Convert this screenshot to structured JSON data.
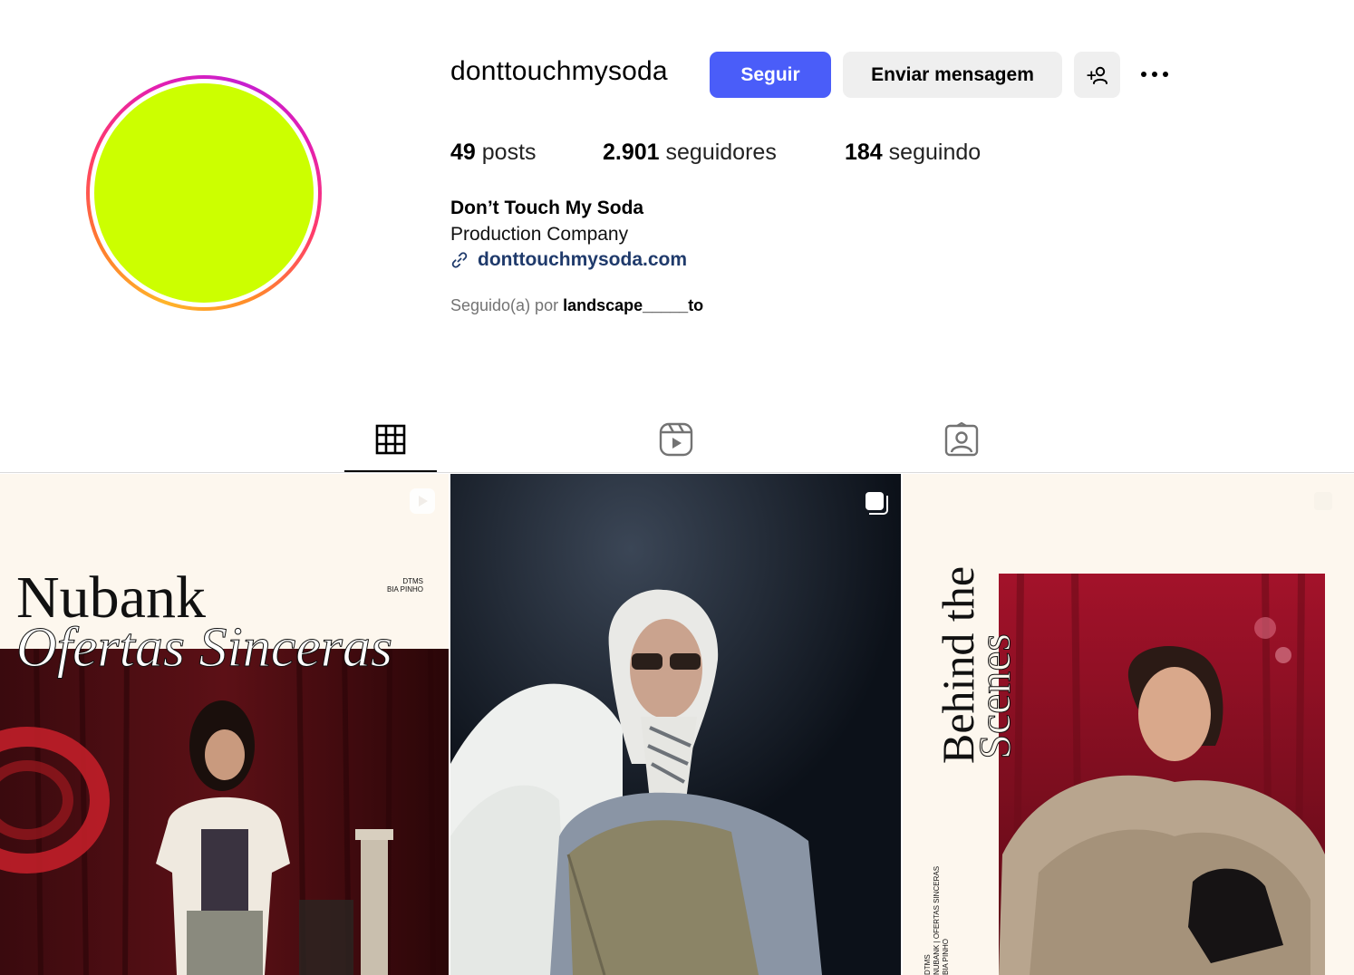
{
  "profile": {
    "username": "donttouchmysoda",
    "avatar_color": "#ccff00",
    "has_story_ring": true
  },
  "actions": {
    "follow_label": "Seguir",
    "message_label": "Enviar mensagem",
    "add_user_icon": "add-person-icon",
    "more_icon": "more-options-icon",
    "follow_color": "#4a5df9"
  },
  "stats": {
    "posts_count": "49",
    "posts_label": "posts",
    "followers_count": "2.901",
    "followers_label": "seguidores",
    "following_count": "184",
    "following_label": "seguindo"
  },
  "bio": {
    "name": "Don’t Touch My Soda",
    "category": "Production Company",
    "link": "donttouchmysoda.com",
    "followed_by_prefix": "Seguido(a) por",
    "followed_by_user": "landscape_____to"
  },
  "tabs": [
    {
      "icon": "grid-icon",
      "active": true
    },
    {
      "icon": "reels-icon",
      "active": false
    },
    {
      "icon": "tagged-icon",
      "active": false
    }
  ],
  "posts": [
    {
      "type": "reel",
      "title_line1": "Nubank",
      "title_line2": "Ofertas Sinceras",
      "credits_line1": "DTMS",
      "credits_line2": "BIA PINHO"
    },
    {
      "type": "carousel"
    },
    {
      "type": "carousel",
      "title_line1": "Behind the",
      "title_line2": "Scenes",
      "side_line1": "DTMS",
      "side_line2": "NUBANK | OFERTAS SINCERAS",
      "side_line3": "BIA PINHO"
    }
  ]
}
